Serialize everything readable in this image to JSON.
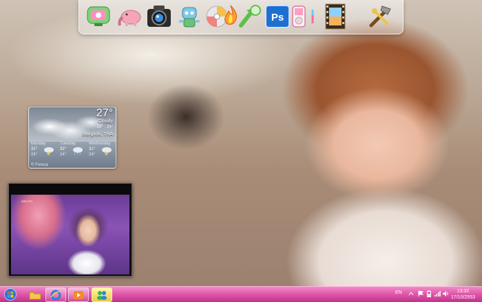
{
  "weather": {
    "current_temp": "27°",
    "condition": "Cloudy",
    "range": "29° - 24°",
    "location": "Bangkok, THA",
    "forecast": [
      {
        "day": "Monday",
        "high": "31°",
        "low": "24°"
      },
      {
        "day": "Tuesday",
        "high": "32°",
        "low": "24°"
      },
      {
        "day": "Wednesday",
        "high": "31°",
        "low": "24°"
      }
    ],
    "credit": "© Foreca"
  },
  "video": {
    "channel_logo": "KBS 2TV"
  },
  "taskbar": {
    "language": "EN",
    "time": "13:32",
    "date": "17/10/2553"
  },
  "dock_icons": [
    "monitor-icon",
    "elephant-icon",
    "camera-icon",
    "robot-icon",
    "disc-icon",
    "burn-icon",
    "sync-arrow-icon",
    "photoshop-icon",
    "ipod-icon",
    "film-icon",
    "tools-icon"
  ],
  "colors": {
    "taskbar": "#e05aaa",
    "photoshop": "#1f6fd1"
  }
}
